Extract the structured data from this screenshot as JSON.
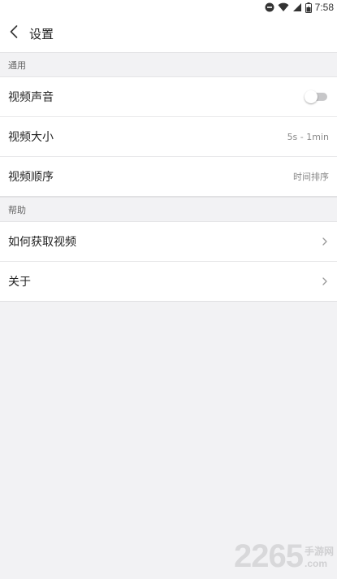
{
  "status_bar": {
    "time": "7:58",
    "icons": [
      "dnd-icon",
      "wifi-icon",
      "signal-icon",
      "battery-icon"
    ]
  },
  "header": {
    "back_icon": "chevron-left-icon",
    "title": "设置"
  },
  "sections": [
    {
      "title": "通用",
      "rows": [
        {
          "label": "视频声音",
          "control": "toggle",
          "toggle_on": false
        },
        {
          "label": "视频大小",
          "value": "5s - 1min"
        },
        {
          "label": "视频顺序",
          "value": "时间排序"
        }
      ]
    },
    {
      "title": "帮助",
      "rows": [
        {
          "label": "如何获取视频",
          "control": "chevron",
          "icon": "chevron-right-icon"
        },
        {
          "label": "关于",
          "control": "chevron",
          "icon": "chevron-right-icon"
        }
      ]
    }
  ],
  "watermark": {
    "number": "2265",
    "suffix_cn": "手游网",
    "suffix_com": ".com"
  },
  "colors": {
    "background": "#f2f2f4",
    "row_background": "#ffffff",
    "divider": "#e8e8ea",
    "secondary_text": "#888888",
    "toggle_off": "#c7c7c9"
  }
}
